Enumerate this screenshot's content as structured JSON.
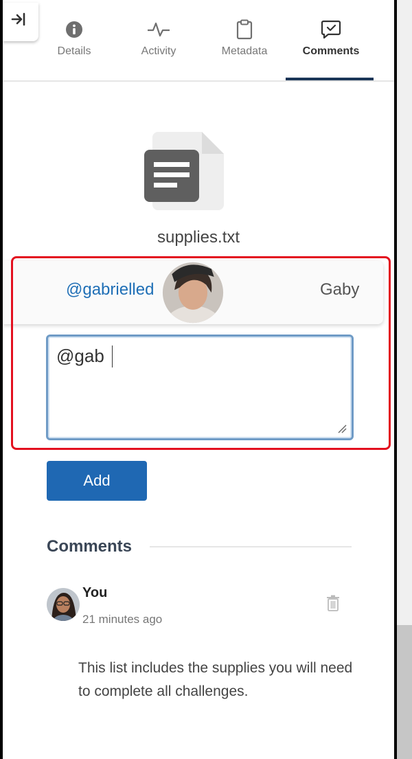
{
  "tabs": [
    {
      "label": "Details",
      "icon": "info-icon"
    },
    {
      "label": "Activity",
      "icon": "activity-icon"
    },
    {
      "label": "Metadata",
      "icon": "clipboard-icon"
    },
    {
      "label": "Comments",
      "icon": "comment-check-icon"
    }
  ],
  "active_tab": "Comments",
  "file": {
    "name": "supplies.txt",
    "icon": "text-file-icon"
  },
  "mention_suggestion": {
    "handle": "@gabrielled",
    "name": "Gaby"
  },
  "comment_input": {
    "value": "@gab"
  },
  "add_button": {
    "label": "Add"
  },
  "comments_section": {
    "heading": "Comments",
    "items": [
      {
        "author": "You",
        "time": "21 minutes ago",
        "text": "This list includes the supplies you will need to complete all challenges."
      }
    ]
  },
  "colors": {
    "accent": "#1f68b3",
    "link": "#1f6fb6",
    "highlight": "#e3101f",
    "tab_underline": "#1a3557"
  }
}
